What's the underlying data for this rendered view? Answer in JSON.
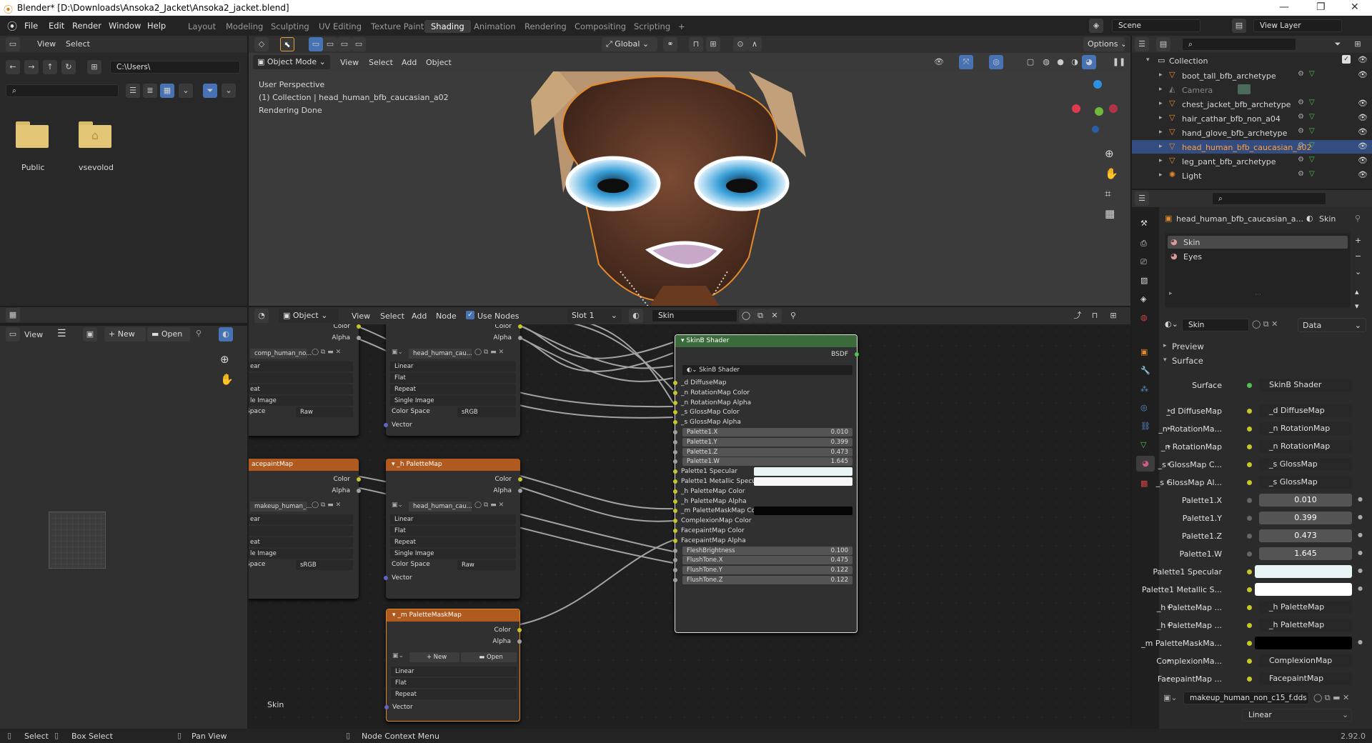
{
  "window": {
    "title": "Blender* [D:\\Downloads\\Ansoka2_Jacket\\Ansoka2_jacket.blend]",
    "minimize": "—",
    "maximize": "❐",
    "close": "✕"
  },
  "menu": [
    "File",
    "Edit",
    "Render",
    "Window",
    "Help"
  ],
  "workspaces": [
    "Layout",
    "Modeling",
    "Sculpting",
    "UV Editing",
    "Texture Paint",
    "Shading",
    "Animation",
    "Rendering",
    "Compositing",
    "Scripting",
    "+"
  ],
  "scene": {
    "name": "Scene",
    "view_layer": "View Layer"
  },
  "file_browser": {
    "menus": [
      "View",
      "Select"
    ],
    "path": "C:\\Users\\",
    "folders": [
      "Public",
      "vsevolod"
    ]
  },
  "viewport": {
    "mode": "Object Mode",
    "menus": [
      "View",
      "Select",
      "Add",
      "Object"
    ],
    "orientation": "Global",
    "options": "Options",
    "info": [
      "User Perspective",
      "(1) Collection | head_human_bfb_caucasian_a02",
      "Rendering Done"
    ]
  },
  "image_editor": {
    "view": "View",
    "new": "New",
    "open": "Open"
  },
  "node_editor": {
    "type": "Object",
    "menus": [
      "View",
      "Select",
      "Add",
      "Node"
    ],
    "use_nodes": "Use Nodes",
    "slot": "Slot 1",
    "material": "Skin",
    "footer_label": "Skin"
  },
  "nodes": {
    "left1": {
      "outputs": [
        "Color",
        "Alpha"
      ],
      "image": "comp_human_no...",
      "rows": [
        "ear",
        "",
        "eat",
        "le Image",
        "Space",
        "r"
      ],
      "space_val": "Raw"
    },
    "mid1": {
      "outputs": [
        "Color",
        "Alpha"
      ],
      "image": "head_human_cau...",
      "rows": [
        "Linear",
        "Flat",
        "Repeat",
        "Single Image",
        "Color Space",
        "Vector"
      ],
      "space_val": "sRGB"
    },
    "left2": {
      "title": "acepaintMap",
      "outputs": [
        "Color",
        "Alpha"
      ],
      "image": "makeup_human_...",
      "rows": [
        "ear",
        "",
        "eat",
        "le Image",
        "Space",
        "r"
      ],
      "space_val": "sRGB"
    },
    "mid2": {
      "title": "_h PaletteMap",
      "outputs": [
        "Color",
        "Alpha"
      ],
      "image": "head_human_cau...",
      "rows": [
        "Linear",
        "Flat",
        "Repeat",
        "Single Image",
        "Color Space",
        "Vector"
      ],
      "space_val": "Raw"
    },
    "mid3": {
      "title": "_m PaletteMaskMap",
      "outputs": [
        "Color",
        "Alpha"
      ],
      "new": "New",
      "open": "Open",
      "rows": [
        "Linear",
        "Flat",
        "Repeat",
        "Vector"
      ]
    },
    "shader": {
      "title": "SkinB Shader",
      "output": "BSDF",
      "group": "SkinB Shader",
      "inputs": [
        "_d DiffuseMap",
        "_n RotationMap Color",
        "_n RotationMap Alpha",
        "_s GlossMap Color",
        "_s GlossMap Alpha"
      ],
      "values": [
        {
          "label": "Palette1.X",
          "value": "0.010"
        },
        {
          "label": "Palette1.Y",
          "value": "0.399"
        },
        {
          "label": "Palette1.Z",
          "value": "0.473"
        },
        {
          "label": "Palette1.W",
          "value": "1.645"
        }
      ],
      "colors": [
        {
          "label": "Palette1 Specular",
          "color": "#e8f3f5"
        },
        {
          "label": "Palette1 Metallic Specular",
          "color": "#f5f5f5"
        }
      ],
      "inputs2": [
        "_h PaletteMap Color",
        "_h PaletteMap Alpha"
      ],
      "mask": {
        "label": "_m PaletteMaskMap Color",
        "color": "#050505"
      },
      "inputs3": [
        "ComplexionMap Color",
        "FacepaintMap Color",
        "FacepaintMap Alpha"
      ],
      "values2": [
        {
          "label": "FleshBrightness",
          "value": "0.100"
        },
        {
          "label": "FlushTone.X",
          "value": "0.475"
        },
        {
          "label": "FlushTone.Y",
          "value": "0.122"
        },
        {
          "label": "FlushTone.Z",
          "value": "0.122"
        }
      ]
    }
  },
  "outliner": {
    "root": "Collection",
    "items": [
      "boot_tall_bfb_archetype",
      "Camera",
      "chest_jacket_bfb_archetype",
      "hair_cathar_bfb_non_a04",
      "hand_glove_bfb_archetype",
      "head_human_bfb_caucasian_a02",
      "leg_pant_bfb_archetype",
      "Light"
    ],
    "selected": 5
  },
  "properties": {
    "object": "head_human_bfb_caucasian_a...",
    "material_tag": "Skin",
    "slots": [
      "Skin",
      "Eyes"
    ],
    "material": "Skin",
    "data": "Data",
    "preview": "Preview",
    "surface_section": "Surface",
    "surface": {
      "label": "Surface",
      "value": "SkinB Shader"
    },
    "links": [
      {
        "label": "_d DiffuseMap",
        "value": "_d DiffuseMap"
      },
      {
        "label": "_n RotationMa...",
        "value": "_n RotationMap"
      },
      {
        "label": "_n RotationMap",
        "value": "_n RotationMap"
      },
      {
        "label": "_s GlossMap C...",
        "value": "_s GlossMap"
      },
      {
        "label": "_s GlossMap Al...",
        "value": "_s GlossMap"
      }
    ],
    "nums": [
      {
        "label": "Palette1.X",
        "value": "0.010"
      },
      {
        "label": "Palette1.Y",
        "value": "0.399"
      },
      {
        "label": "Palette1.Z",
        "value": "0.473"
      },
      {
        "label": "Palette1.W",
        "value": "1.645"
      }
    ],
    "cols": [
      {
        "label": "Palette1 Specular",
        "color": "#e8f3f5"
      },
      {
        "label": "Palette1 Metallic S...",
        "color": "#ffffff"
      }
    ],
    "links2": [
      {
        "label": "_h PaletteMap ...",
        "value": "_h PaletteMap"
      },
      {
        "label": "_h PaletteMap ...",
        "value": "_h PaletteMap"
      }
    ],
    "mask": {
      "label": "_m PaletteMaskMa...",
      "color": "#000000"
    },
    "links3": [
      {
        "label": "ComplexionMa...",
        "value": "ComplexionMap"
      },
      {
        "label": "FacepaintMap ...",
        "value": "FacepaintMap"
      }
    ],
    "image": "makeup_human_non_c15_f.dds",
    "interp": "Linear"
  },
  "statusbar": {
    "select": "Select",
    "box_select": "Box Select",
    "pan": "Pan View",
    "context": "Node Context Menu",
    "version": "2.92.0"
  }
}
